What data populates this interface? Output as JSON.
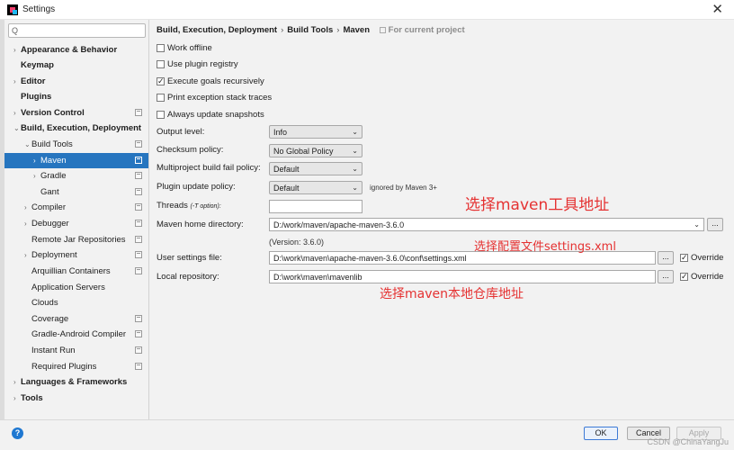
{
  "window": {
    "title": "Settings",
    "close_glyph": "✕"
  },
  "sidebar": {
    "search_icon_glyph": "Q",
    "search_placeholder": "",
    "items": [
      {
        "label": "Appearance & Behavior",
        "bold": true,
        "arrow": "›"
      },
      {
        "label": "Keymap",
        "bold": true,
        "arrow": ""
      },
      {
        "label": "Editor",
        "bold": true,
        "arrow": "›"
      },
      {
        "label": "Plugins",
        "bold": true,
        "arrow": ""
      },
      {
        "label": "Version Control",
        "bold": true,
        "arrow": "›"
      },
      {
        "label": "Build, Execution, Deployment",
        "bold": true,
        "arrow": "⌄"
      },
      {
        "label": "Build Tools",
        "bold": false,
        "arrow": "⌄"
      },
      {
        "label": "Maven",
        "bold": false,
        "arrow": "›"
      },
      {
        "label": "Gradle",
        "bold": false,
        "arrow": "›"
      },
      {
        "label": "Gant",
        "bold": false,
        "arrow": ""
      },
      {
        "label": "Compiler",
        "bold": false,
        "arrow": "›"
      },
      {
        "label": "Debugger",
        "bold": false,
        "arrow": "›"
      },
      {
        "label": "Remote Jar Repositories",
        "bold": false,
        "arrow": ""
      },
      {
        "label": "Deployment",
        "bold": false,
        "arrow": "›"
      },
      {
        "label": "Arquillian Containers",
        "bold": false,
        "arrow": ""
      },
      {
        "label": "Application Servers",
        "bold": false,
        "arrow": ""
      },
      {
        "label": "Clouds",
        "bold": false,
        "arrow": ""
      },
      {
        "label": "Coverage",
        "bold": false,
        "arrow": ""
      },
      {
        "label": "Gradle-Android Compiler",
        "bold": false,
        "arrow": ""
      },
      {
        "label": "Instant Run",
        "bold": false,
        "arrow": ""
      },
      {
        "label": "Required Plugins",
        "bold": false,
        "arrow": ""
      },
      {
        "label": "Languages & Frameworks",
        "bold": true,
        "arrow": "›"
      },
      {
        "label": "Tools",
        "bold": true,
        "arrow": "›"
      }
    ],
    "selected_label": "Maven"
  },
  "breadcrumb": {
    "parts": [
      "Build, Execution, Deployment",
      "Build Tools",
      "Maven"
    ],
    "separator": "›",
    "scope_note": "For current project"
  },
  "options": {
    "checkboxes": [
      {
        "label": "Work offline",
        "checked": false
      },
      {
        "label": "Use plugin registry",
        "checked": false
      },
      {
        "label": "Execute goals recursively",
        "checked": true
      },
      {
        "label": "Print exception stack traces",
        "checked": false
      },
      {
        "label": "Always update snapshots",
        "checked": false
      }
    ],
    "output_level": {
      "label": "Output level:",
      "value": "Info"
    },
    "checksum_policy": {
      "label": "Checksum policy:",
      "value": "No Global Policy"
    },
    "multiproject_fail_policy": {
      "label": "Multiproject build fail policy:",
      "value": "Default"
    },
    "plugin_update_policy": {
      "label": "Plugin update policy:",
      "value": "Default",
      "note": "ignored by Maven 3+"
    },
    "threads": {
      "label": "Threads",
      "hint": "(-T option):",
      "value": ""
    },
    "maven_home": {
      "label": "Maven home directory:",
      "value": "D:/work/maven/apache-maven-3.6.0",
      "version": "(Version: 3.6.0)"
    },
    "user_settings": {
      "label": "User settings file:",
      "value": "D:\\work\\maven\\apache-maven-3.6.0\\conf\\settings.xml",
      "override_label": "Override",
      "override_checked": true
    },
    "local_repository": {
      "label": "Local repository:",
      "value": "D:\\work\\maven\\mavenlib",
      "override_label": "Override",
      "override_checked": true
    },
    "browse_label": "..."
  },
  "annotations": {
    "maven_home": "选择maven工具地址",
    "settings_file": "选择配置文件settings.xml",
    "local_repo": "选择maven本地仓库地址"
  },
  "footer": {
    "help_glyph": "?",
    "ok_label": "OK",
    "cancel_label": "Cancel",
    "apply_label": "Apply",
    "watermark": "CSDN @ChinaYangJu"
  }
}
